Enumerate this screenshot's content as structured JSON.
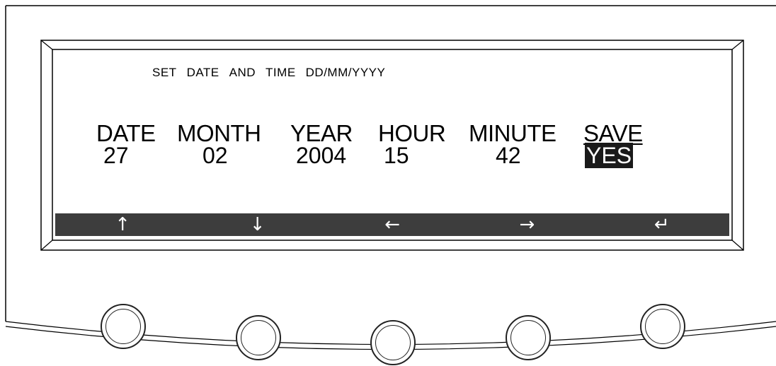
{
  "screen": {
    "title_words": [
      "SET",
      "DATE",
      "AND",
      "TIME",
      "DD/MM/YYYY"
    ],
    "fields": [
      {
        "label": "DATE",
        "value": "27"
      },
      {
        "label": "MONTH",
        "value": "02"
      },
      {
        "label": "YEAR",
        "value": "2004"
      },
      {
        "label": "HOUR",
        "value": "15"
      },
      {
        "label": "MINUTE",
        "value": "42"
      },
      {
        "label": "SAVE",
        "value": "YES"
      }
    ]
  },
  "softkeys": [
    {
      "glyph": "↑",
      "icon": "arrow-up-icon"
    },
    {
      "glyph": "↓",
      "icon": "arrow-down-icon"
    },
    {
      "glyph": "←",
      "icon": "arrow-left-icon"
    },
    {
      "glyph": "→",
      "icon": "arrow-right-icon"
    },
    {
      "glyph": "↵",
      "icon": "enter-icon"
    }
  ],
  "colors": {
    "softkey_bar": "#3d3d3d",
    "highlight": "#1a1a1a"
  }
}
